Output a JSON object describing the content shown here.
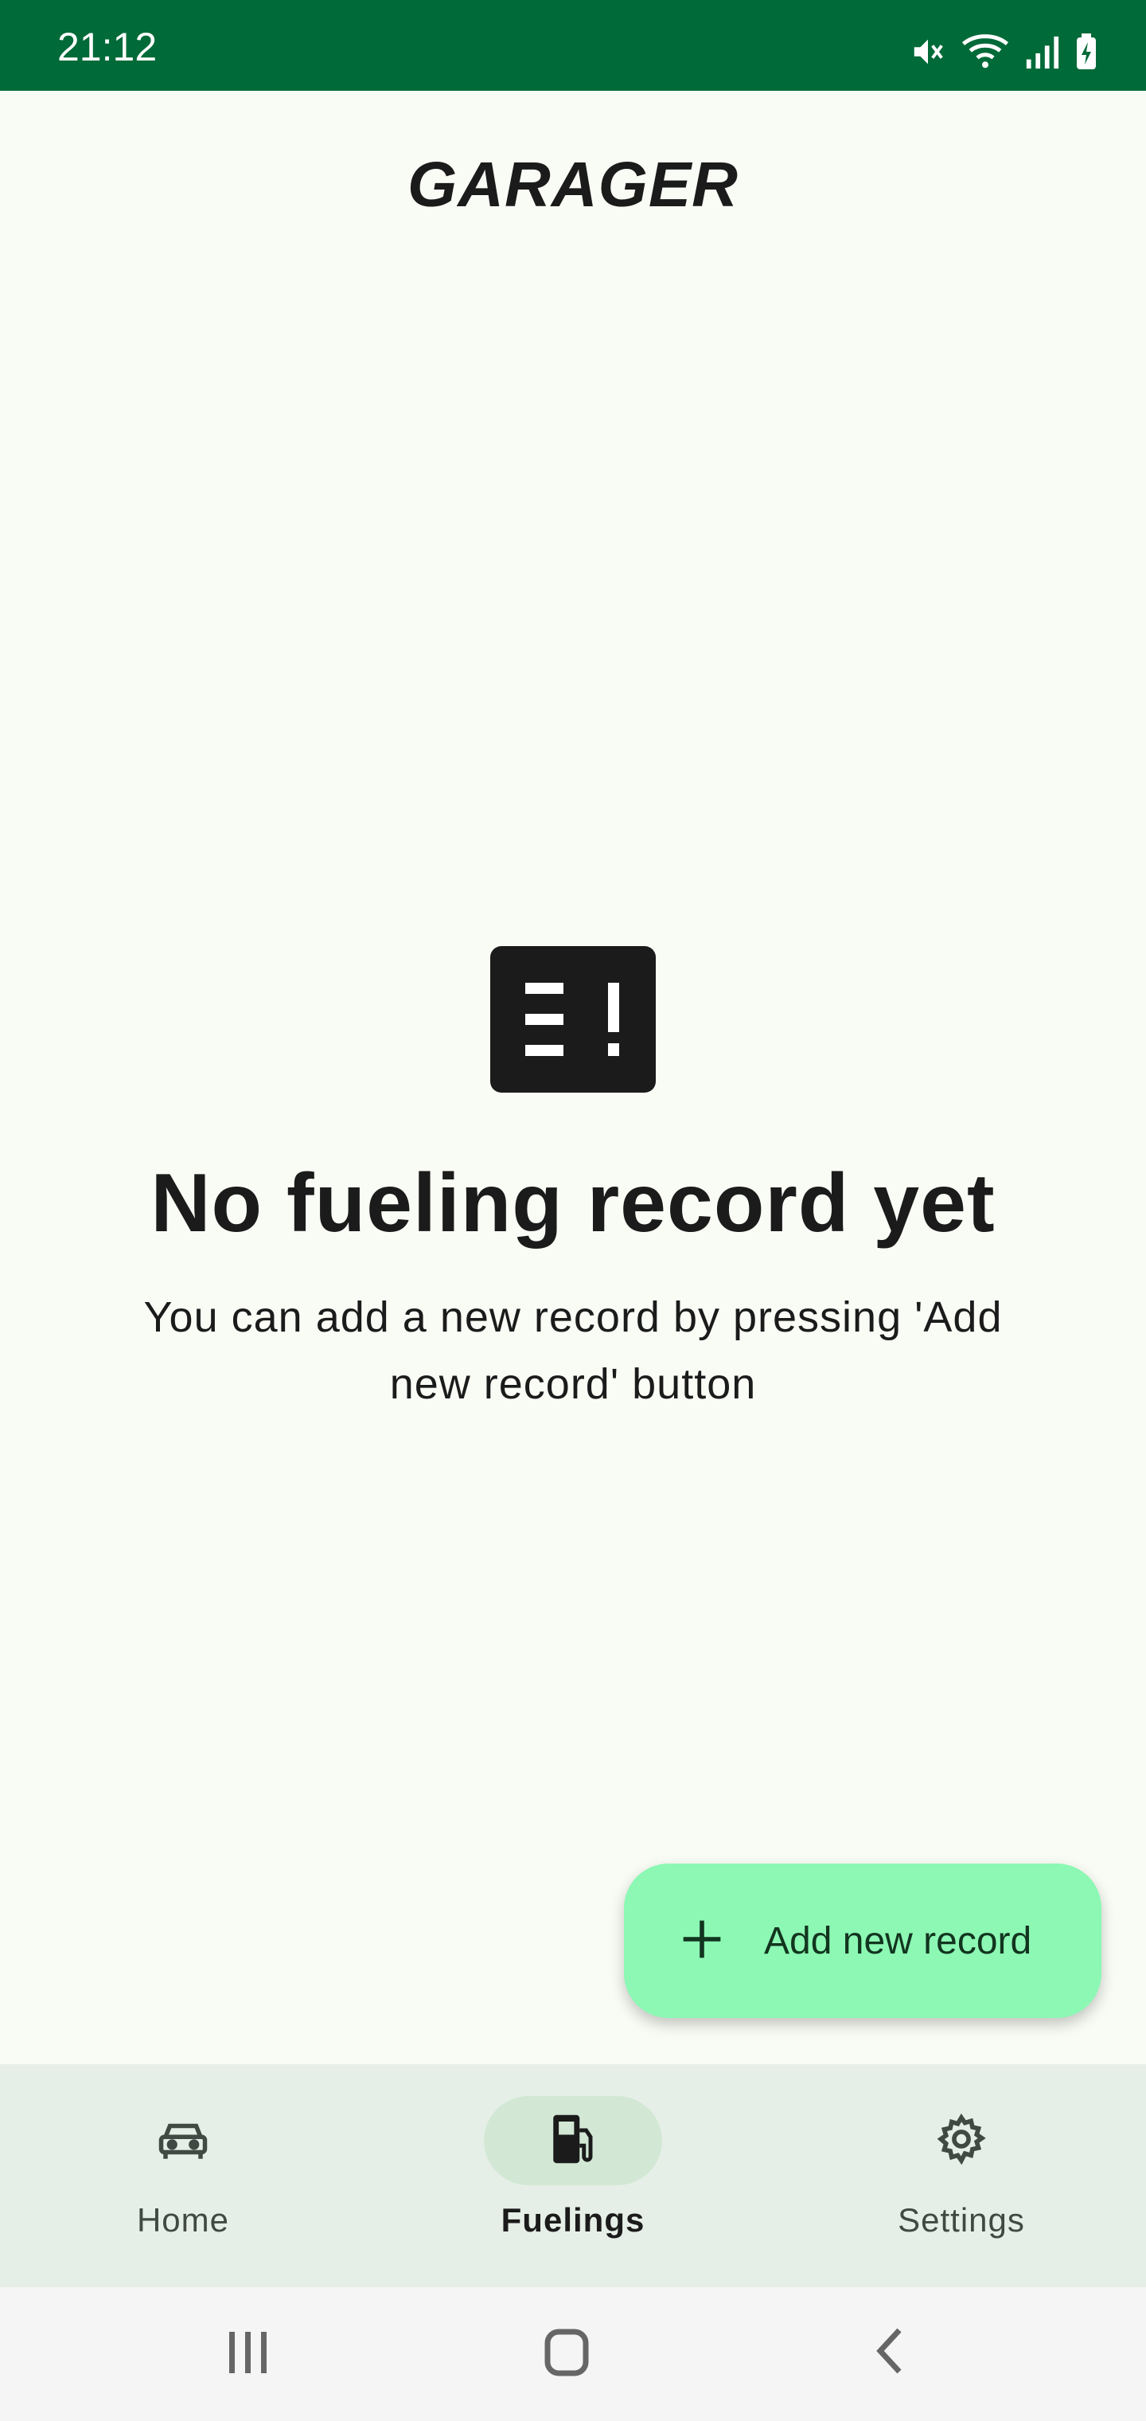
{
  "status_bar": {
    "time": "21:12",
    "icons": [
      "mute-icon",
      "wifi-icon",
      "signal-icon",
      "battery-charging-icon"
    ]
  },
  "app": {
    "title": "GARAGER"
  },
  "empty_state": {
    "icon": "fuel-alert-icon",
    "title": "No fueling record yet",
    "description": "You can add a new record by pressing 'Add new record' button"
  },
  "fab": {
    "icon": "plus-icon",
    "label": "Add new record"
  },
  "bottom_nav": {
    "items": [
      {
        "label": "Home",
        "icon": "car-icon",
        "active": false
      },
      {
        "label": "Fuelings",
        "icon": "fuel-pump-icon",
        "active": true
      },
      {
        "label": "Settings",
        "icon": "gear-icon",
        "active": false
      }
    ]
  },
  "colors": {
    "status_bar": "#006a38",
    "background": "#f9fbf5",
    "fab": "#8cf8b4",
    "nav_bar": "#e6efe7",
    "nav_active_pill": "#d2e8d5"
  }
}
